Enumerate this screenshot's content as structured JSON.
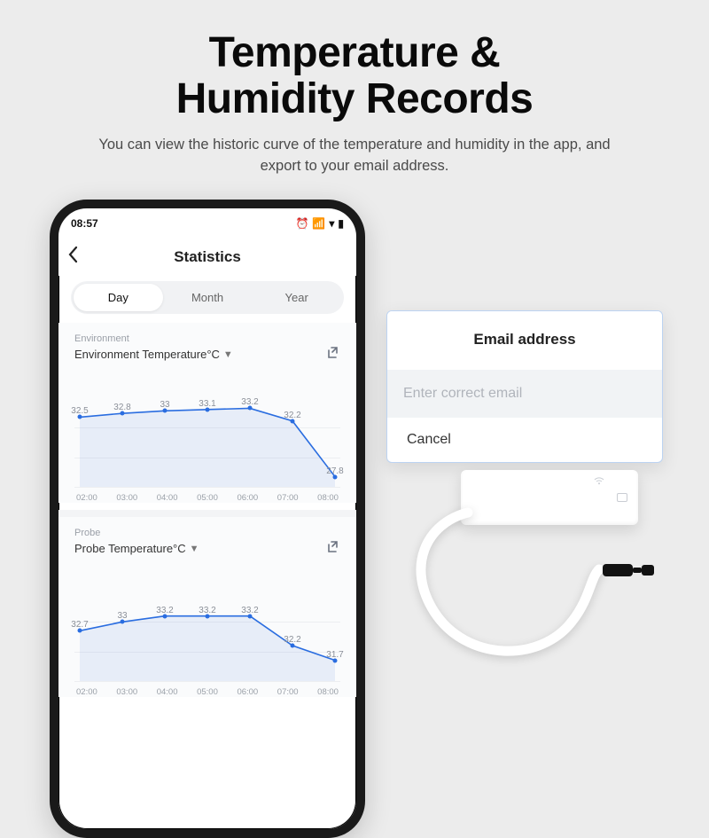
{
  "marketing": {
    "headline_line1": "Temperature &",
    "headline_line2": "Humidity Records",
    "subhead": "You can view the historic curve of the temperature and  humidity in the app, and export to your email address."
  },
  "statusbar": {
    "time": "08:57"
  },
  "app": {
    "title": "Statistics",
    "tabs": {
      "day": "Day",
      "month": "Month",
      "year": "Year",
      "active": "day"
    },
    "env": {
      "category": "Environment",
      "metric": "Environment Temperature°C"
    },
    "probe": {
      "category": "Probe",
      "metric": "Probe Temperature°C"
    }
  },
  "popup": {
    "title": "Email address",
    "placeholder": "Enter correct email",
    "cancel": "Cancel"
  },
  "chart_data": [
    {
      "type": "line",
      "title": "Environment Temperature°C",
      "xlabel": "",
      "ylabel": "",
      "categories": [
        "02:00",
        "03:00",
        "04:00",
        "05:00",
        "06:00",
        "07:00",
        "08:00"
      ],
      "values": [
        32.5,
        32.8,
        33,
        33.1,
        33.2,
        32.2,
        27.8
      ],
      "ylim": [
        27,
        34
      ]
    },
    {
      "type": "line",
      "title": "Probe Temperature°C",
      "xlabel": "",
      "ylabel": "",
      "categories": [
        "02:00",
        "03:00",
        "04:00",
        "05:00",
        "06:00",
        "07:00",
        "08:00"
      ],
      "values": [
        32.7,
        33,
        33.2,
        33.2,
        33.2,
        32.2,
        31.7
      ],
      "ylim": [
        31,
        34
      ]
    }
  ]
}
